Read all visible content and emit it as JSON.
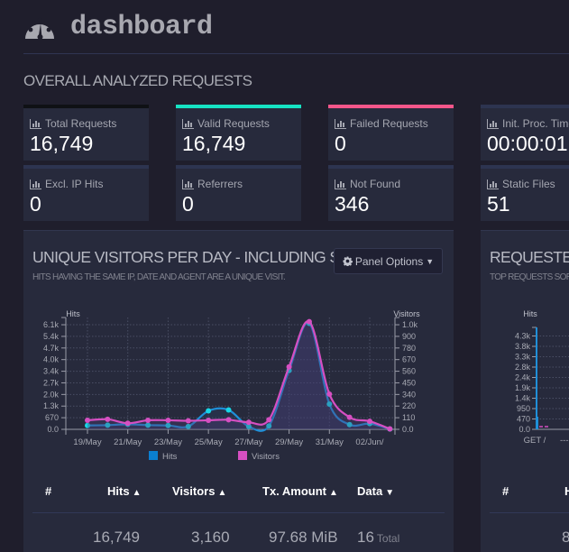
{
  "header": {
    "icon": "dashboard-gauge-icon",
    "title": "dashboard"
  },
  "overall": {
    "title": "OVERALL ANALYZED REQUESTS",
    "cards": [
      {
        "label": "Total Requests",
        "value": "16,749",
        "icon": "bar-chart-icon",
        "accent": "#0f1115"
      },
      {
        "label": "Valid Requests",
        "value": "16,749",
        "icon": "bar-chart-icon",
        "accent": "#16e3c3"
      },
      {
        "label": "Failed Requests",
        "value": "0",
        "icon": "bar-chart-icon",
        "accent": "#f5568a"
      },
      {
        "label": "Init. Proc. Time",
        "value": "00:00:01",
        "icon": "bar-chart-icon",
        "accent": "#2d3450"
      },
      {
        "label": "Excl. IP Hits",
        "value": "0",
        "icon": "bar-chart-icon",
        "accent": "#2d3450"
      },
      {
        "label": "Referrers",
        "value": "0",
        "icon": "bar-chart-icon",
        "accent": "#2d3450"
      },
      {
        "label": "Not Found",
        "value": "346",
        "icon": "bar-chart-icon",
        "accent": "#2d3450"
      },
      {
        "label": "Static Files",
        "value": "51",
        "icon": "bar-chart-icon",
        "accent": "#2d3450"
      }
    ]
  },
  "visitors_panel": {
    "title": "UNIQUE VISITORS PER DAY - INCLUDING SPIDERS",
    "subtitle": "HITS HAVING THE SAME IP, DATE AND AGENT ARE A UNIQUE VISIT.",
    "options_label": "Panel Options",
    "options_icon": "gear-icon",
    "table": {
      "headers": [
        "#",
        "Hits",
        "Visitors",
        "Tx. Amount",
        "Data"
      ],
      "summary": {
        "hits": "16,749",
        "visitors": "3,160",
        "tx_amount": "97.68 MiB",
        "data": "16",
        "data_suffix": "Total"
      }
    }
  },
  "requests_panel": {
    "title": "REQUESTED FILES (URLS)",
    "subtitle": "TOP REQUESTS SORTED BY HITS",
    "y_label": "Hits",
    "y_ticks": [
      "0.0",
      "470",
      "950",
      "1.4k",
      "1.9k",
      "2.4k",
      "2.8k",
      "3.3k",
      "3.8k",
      "4.3k"
    ],
    "x_ticks": [
      "GET /",
      "--- "
    ],
    "table_headers": [
      "#",
      "Hits"
    ],
    "table_first_value": "8"
  },
  "chart_data": {
    "type": "line",
    "title": "UNIQUE VISITORS PER DAY - INCLUDING SPIDERS",
    "xlabel": "",
    "ylabel": "Hits",
    "y2label": "Visitors",
    "x": [
      "19/May",
      "20/May",
      "21/May",
      "22/May",
      "23/May",
      "24/May",
      "25/May",
      "26/May",
      "27/May",
      "28/May",
      "29/May",
      "30/May",
      "31/May",
      "01/Jun",
      "02/Jun",
      "03/Jun"
    ],
    "x_tick_labels": [
      "19/May",
      "21/May",
      "23/May",
      "25/May",
      "27/May",
      "29/May",
      "31/May",
      "02/Jun/"
    ],
    "y_ticks": [
      "0.0",
      "670",
      "1.3k",
      "2.0k",
      "2.7k",
      "3.4k",
      "4.0k",
      "4.7k",
      "5.4k",
      "6.1k"
    ],
    "y2_ticks": [
      "0.0",
      "110",
      "220",
      "340",
      "450",
      "560",
      "670",
      "780",
      "900",
      "1.0k"
    ],
    "ylim": [
      0,
      6700
    ],
    "y2lim": [
      0,
      1120
    ],
    "grid": true,
    "legend_position": "bottom",
    "series": [
      {
        "name": "Hits",
        "axis": "left",
        "color": "#1f8fd8",
        "marker_color": "#17d6e6",
        "values": [
          230,
          250,
          300,
          250,
          230,
          170,
          1100,
          1150,
          170,
          200,
          3500,
          6300,
          1500,
          280,
          340,
          20
        ]
      },
      {
        "name": "Visitors",
        "axis": "right",
        "color": "#d64fc2",
        "marker_color": "#d64fc2",
        "values": [
          90,
          100,
          60,
          90,
          90,
          85,
          90,
          95,
          70,
          95,
          620,
          1070,
          350,
          120,
          80,
          5
        ]
      }
    ]
  }
}
